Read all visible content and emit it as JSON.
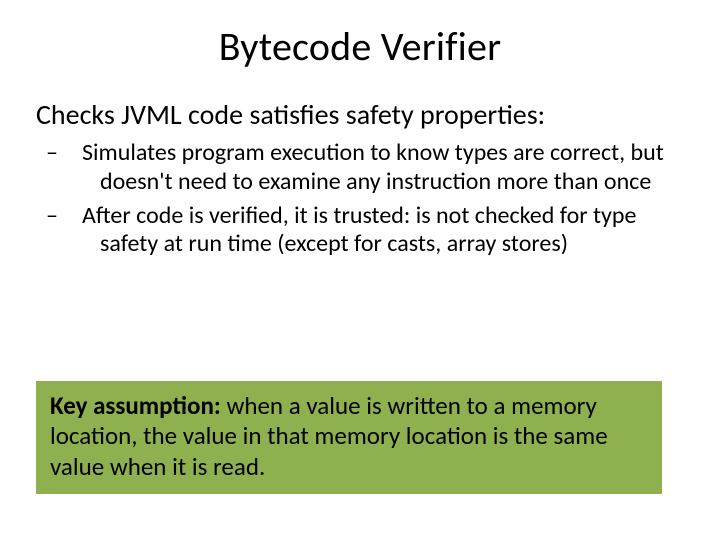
{
  "title": "Bytecode Verifier",
  "lead": "Checks JVML code satisfies safety properties:",
  "bullets": [
    "Simulates program execution to know types are correct, but doesn't need to examine any instruction more than once",
    "After code is verified, it is trusted: is not checked for type safety at run time (except for casts, array stores)"
  ],
  "callout": {
    "label": "Key assumption:",
    "text": " when a value is written to a memory location, the value in that memory location is the same value when it is read."
  }
}
